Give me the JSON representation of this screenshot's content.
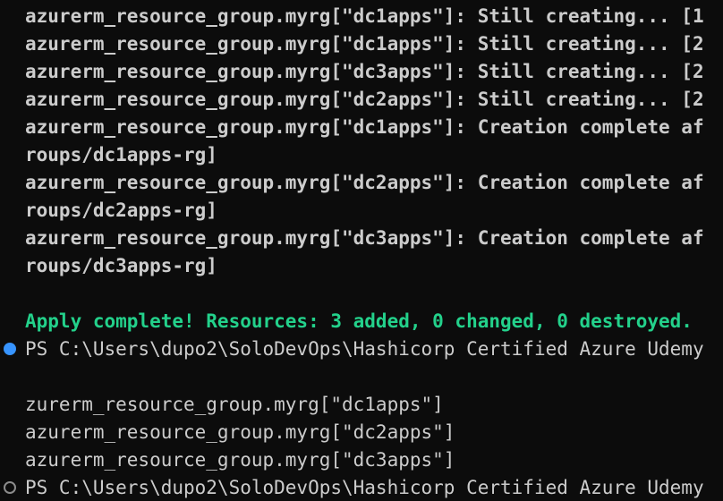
{
  "terminal": {
    "lines": [
      "azurerm_resource_group.myrg[\"dc1apps\"]: Still creating... [1",
      "azurerm_resource_group.myrg[\"dc1apps\"]: Still creating... [2",
      "azurerm_resource_group.myrg[\"dc3apps\"]: Still creating... [2",
      "azurerm_resource_group.myrg[\"dc2apps\"]: Still creating... [2",
      "azurerm_resource_group.myrg[\"dc1apps\"]: Creation complete af",
      "roups/dc1apps-rg]",
      "azurerm_resource_group.myrg[\"dc2apps\"]: Creation complete af",
      "roups/dc2apps-rg]",
      "azurerm_resource_group.myrg[\"dc3apps\"]: Creation complete af",
      "roups/dc3apps-rg]",
      "",
      "Apply complete! Resources: 3 added, 0 changed, 0 destroyed.",
      "PS C:\\Users\\dupo2\\SoloDevOps\\Hashicorp Certified Azure Udemy",
      "",
      "zurerm_resource_group.myrg[\"dc1apps\"]",
      "azurerm_resource_group.myrg[\"dc2apps\"]",
      "azurerm_resource_group.myrg[\"dc3apps\"]",
      "PS C:\\Users\\dupo2\\SoloDevOps\\Hashicorp Certified Azure Udemy"
    ],
    "accent_colors": {
      "success_text": "#23d18b",
      "prompt_status_success": "#3794ff",
      "prompt_status_pending": "#8c8c8c"
    },
    "icons": [
      "command-success-dot-icon",
      "command-pending-dot-icon"
    ]
  }
}
